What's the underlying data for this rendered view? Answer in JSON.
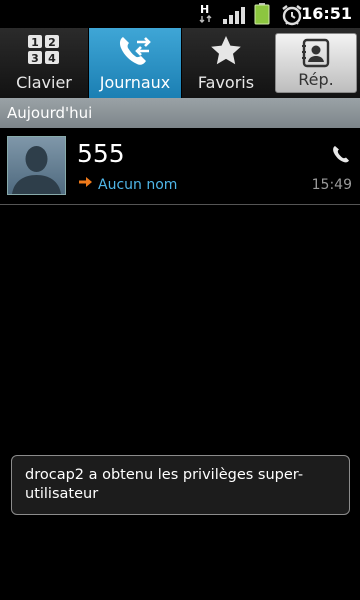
{
  "status_bar": {
    "network_type": "H",
    "time": "16:51",
    "icons": [
      "h-data-icon",
      "signal-icon",
      "battery-icon",
      "alarm-icon"
    ]
  },
  "tabs": [
    {
      "label": "Clavier",
      "icon": "dialpad-icon",
      "selected": false
    },
    {
      "label": "Journaux",
      "icon": "call-log-icon",
      "selected": true
    },
    {
      "label": "Favoris",
      "icon": "star-icon",
      "selected": false
    },
    {
      "label": "Rép.",
      "icon": "contacts-icon",
      "selected": false
    }
  ],
  "dialpad_digits": [
    "1",
    "2",
    "3",
    "4"
  ],
  "section": {
    "title": "Aujourd'hui"
  },
  "log_entries": [
    {
      "name": "555",
      "subtitle": "Aucun nom",
      "time": "15:49",
      "call_type_icon": "outgoing-call-arrow-icon",
      "action_icon": "phone-icon"
    }
  ],
  "toast": {
    "message": "drocap2 a obtenu les privilèges super-utilisateur"
  },
  "colors": {
    "selected_tab": "#1b7fb3",
    "accent_text": "#4fb6e8",
    "outgoing_arrow": "#f07a1a",
    "battery": "#8cc63f"
  }
}
